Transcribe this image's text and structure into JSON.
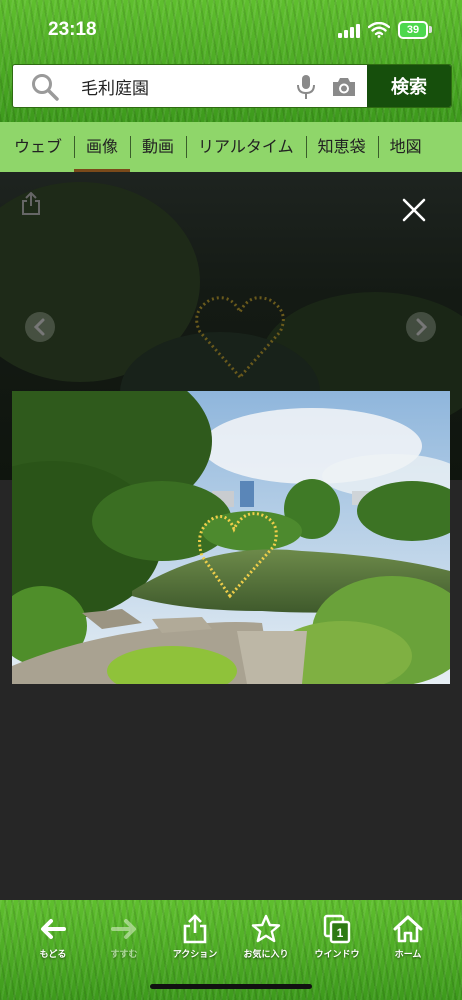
{
  "status_bar": {
    "time": "23:18",
    "battery": "39"
  },
  "search": {
    "query": "毛利庭園",
    "button_label": "検索"
  },
  "tabs": [
    {
      "label": "ウェブ",
      "active": false
    },
    {
      "label": "画像",
      "active": true
    },
    {
      "label": "動画",
      "active": false
    },
    {
      "label": "リアルタイム",
      "active": false
    },
    {
      "label": "知恵袋",
      "active": false
    },
    {
      "label": "地図",
      "active": false
    }
  ],
  "toolbar": {
    "back": "もどる",
    "forward": "すすむ",
    "action": "アクション",
    "favorites": "お気に入り",
    "window": "ウインドウ",
    "window_count": "1",
    "home": "ホーム"
  },
  "colors": {
    "search_button": "#164f0c",
    "tab_bar": "#8fd66a",
    "active_tab_underline": "#7a4a1a",
    "viewer_background": "#262626"
  },
  "icons": [
    "search-icon",
    "mic-icon",
    "camera-icon",
    "share-icon",
    "close-icon",
    "chevron-left-icon",
    "chevron-right-icon",
    "back-arrow-icon",
    "forward-arrow-icon",
    "action-share-icon",
    "star-icon",
    "window-icon",
    "home-icon"
  ]
}
